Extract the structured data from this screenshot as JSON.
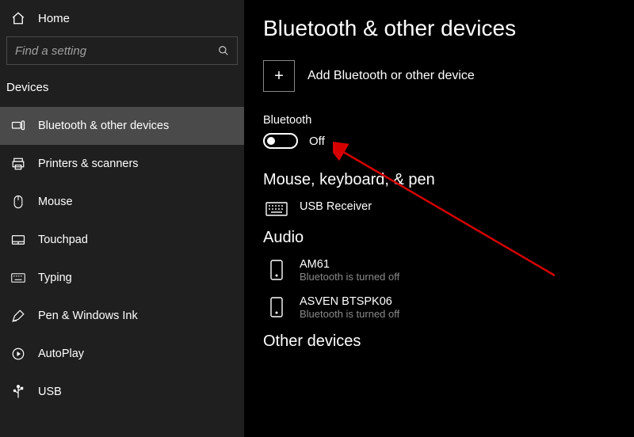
{
  "home_label": "Home",
  "search_placeholder": "Find a setting",
  "category": "Devices",
  "nav": [
    {
      "label": "Bluetooth & other devices"
    },
    {
      "label": "Printers & scanners"
    },
    {
      "label": "Mouse"
    },
    {
      "label": "Touchpad"
    },
    {
      "label": "Typing"
    },
    {
      "label": "Pen & Windows Ink"
    },
    {
      "label": "AutoPlay"
    },
    {
      "label": "USB"
    }
  ],
  "page_title": "Bluetooth & other devices",
  "add_device_label": "Add Bluetooth or other device",
  "bluetooth": {
    "label": "Bluetooth",
    "state": "Off"
  },
  "sections": {
    "mouse_kb_pen": {
      "heading": "Mouse, keyboard, & pen",
      "devices": [
        {
          "name": "USB Receiver",
          "sub": ""
        }
      ]
    },
    "audio": {
      "heading": "Audio",
      "devices": [
        {
          "name": "AM61",
          "sub": "Bluetooth is turned off"
        },
        {
          "name": "ASVEN BTSPK06",
          "sub": "Bluetooth is turned off"
        }
      ]
    },
    "other": {
      "heading": "Other devices"
    }
  }
}
